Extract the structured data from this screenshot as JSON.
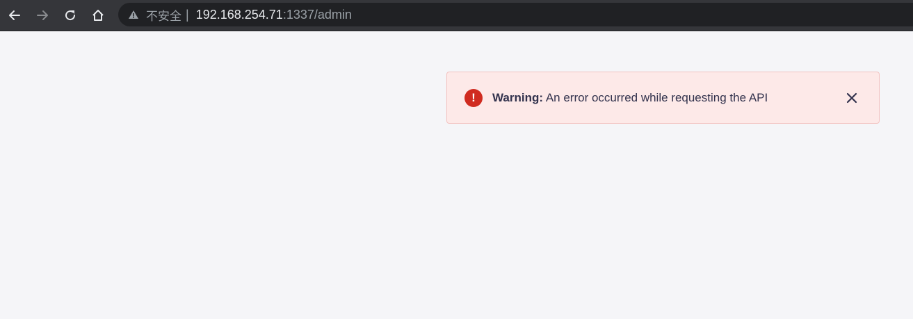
{
  "browser": {
    "security_label": "不安全",
    "security_separator": "|",
    "url_host": "192.168.254.71",
    "url_rest": ":1337/admin",
    "icons": {
      "back": "arrow-left-icon",
      "forward": "arrow-right-icon",
      "reload": "reload-icon",
      "home": "home-icon",
      "security": "warning-triangle-icon"
    }
  },
  "alert": {
    "title": "Warning:",
    "message": "An error occurred while requesting the API",
    "icon": "exclamation-circle-icon",
    "close_icon": "close-icon",
    "colors": {
      "background": "#fde9e8",
      "border": "#f3c2c0",
      "icon": "#d02b20",
      "text": "#32324d"
    }
  },
  "page": {
    "background": "#f5f5f8"
  }
}
